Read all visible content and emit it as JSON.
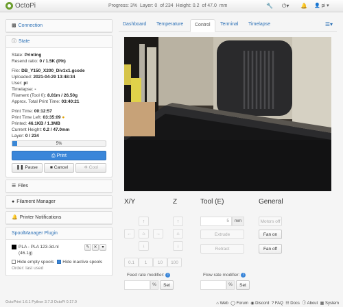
{
  "app": {
    "title": "OctoPi"
  },
  "topbar": {
    "progress_label": "Progress: 3%",
    "layer_label": "Layer: 0",
    "layer_of": "of 234",
    "height_label": "Height: 0.2",
    "height_of": "of 47.0",
    "height_unit": "mm",
    "user": "pi"
  },
  "sidebar": {
    "connection_label": "Connection",
    "state_label": "State",
    "state": {
      "state_key": "State:",
      "state_val": "Printing",
      "resend_key": "Resend ratio:",
      "resend_val": "0 / 1.5K (0%)",
      "file_key": "File:",
      "file_val": "DB_Y150_X200_Div1x1.gcode",
      "uploaded_key": "Uploaded:",
      "uploaded_val": "2021-04-29 13:48:34",
      "user_key": "User:",
      "user_val": "pi",
      "timelapse_key": "Timelapse:",
      "timelapse_val": "-",
      "filament_key": "Filament (Tool 0):",
      "filament_val": "8.81m / 26.50g",
      "approx_key": "Approx. Total Print Time:",
      "approx_val": "03:40:21",
      "ptime_key": "Print Time:",
      "ptime_val": "00:12:57",
      "pleft_key": "Print Time Left:",
      "pleft_val": "03:35:09",
      "printed_key": "Printed:",
      "printed_val": "46.1KB / 1.3MB",
      "height_key": "Current Height:",
      "height_val": "0.2 / 47.0mm",
      "layer_key": "Layer:",
      "layer_val": "0 / 234",
      "progress_pct": 5,
      "progress_text": "5%"
    },
    "buttons": {
      "print": "Print",
      "pause": "Pause",
      "cancel": "Cancel",
      "cool": "Cool"
    },
    "files_label": "Files",
    "filament_manager_label": "Filament Manager",
    "notifications_label": "Printer Notifications",
    "spool_label": "SpoolManager Plugin",
    "spool": {
      "name": "PLA - PLA 123-3d.nl",
      "weight": "(46.1g)",
      "hide_empty": "Hide empty spools",
      "hide_inactive": "Hide inactive spools",
      "order": "Order: last used"
    }
  },
  "tabs": [
    "Dashboard",
    "Temperature",
    "Control",
    "Terminal",
    "Timelapse"
  ],
  "control": {
    "xy_label": "X/Y",
    "z_label": "Z",
    "tool_label": "Tool (E)",
    "general_label": "General",
    "step_sizes": [
      "0.1",
      "1",
      "10",
      "100"
    ],
    "extrude_amount": "5",
    "extrude_unit": "mm",
    "extrude_btn": "Extrude",
    "retract_btn": "Retract",
    "motors_off": "Motors off",
    "fan_on": "Fan on",
    "fan_off": "Fan off",
    "feed_rate_label": "Feed rate modifier:",
    "flow_rate_label": "Flow rate modifier:",
    "percent": "%",
    "set_btn": "Set"
  },
  "footer": {
    "left": "OctoPrint 1.6.1   Python 3.7.3   OctoPi 0.17.0",
    "links": [
      "Web",
      "Forum",
      "Discord",
      "FAQ",
      "Docs",
      "About",
      "System"
    ]
  },
  "colors": {
    "accent": "#3a86d9",
    "brand": "#6c9e2e"
  }
}
